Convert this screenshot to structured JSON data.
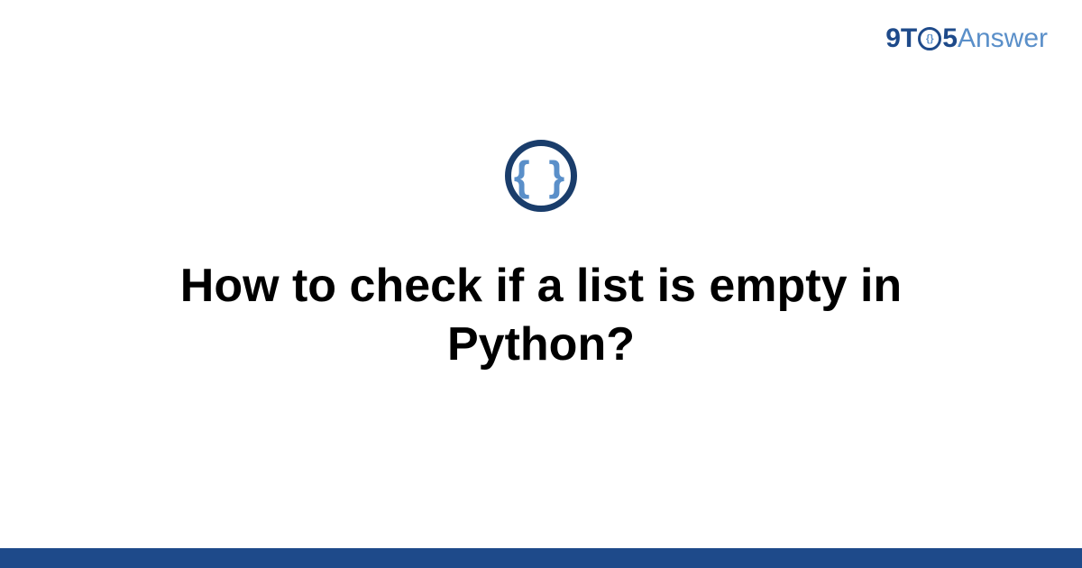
{
  "site": {
    "logo_parts": {
      "p1": "9T",
      "clock_inner": "{}",
      "p2": "5",
      "p3": "Answer"
    }
  },
  "category": {
    "icon_name": "braces-icon",
    "icon_glyph": "{ }"
  },
  "question": {
    "title": "How to check if a list is empty in Python?"
  },
  "colors": {
    "brand_dark": "#1e4a8a",
    "brand_light": "#5a8fc9",
    "text": "#000000"
  }
}
